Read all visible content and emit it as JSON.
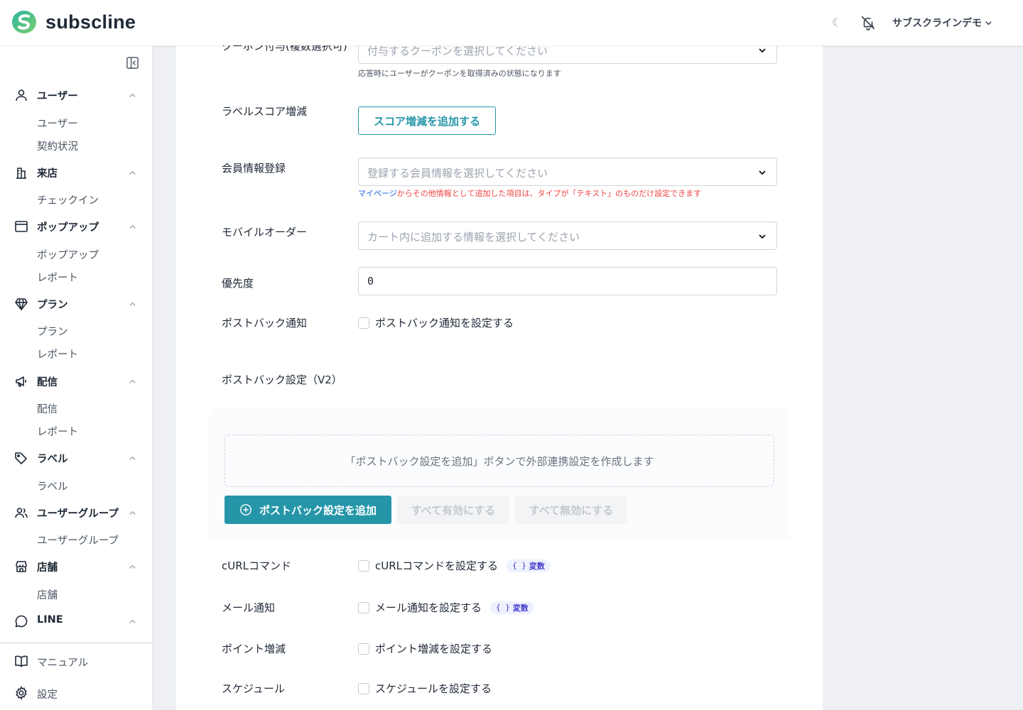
{
  "header": {
    "brand": "subscline",
    "theme_toggle": "☾",
    "user_name": "サブスクラインデモ"
  },
  "sidebar": {
    "groups": [
      {
        "label": "ユーザー",
        "icon": "user-icon",
        "items": [
          "ユーザー",
          "契約状況"
        ]
      },
      {
        "label": "来店",
        "icon": "building-icon",
        "items": [
          "チェックイン"
        ]
      },
      {
        "label": "ポップアップ",
        "icon": "window-icon",
        "items": [
          "ポップアップ",
          "レポート"
        ]
      },
      {
        "label": "プラン",
        "icon": "diamond-icon",
        "items": [
          "プラン",
          "レポート"
        ]
      },
      {
        "label": "配信",
        "icon": "megaphone-icon",
        "items": [
          "配信",
          "レポート"
        ]
      },
      {
        "label": "ラベル",
        "icon": "tag-icon",
        "items": [
          "ラベル"
        ]
      },
      {
        "label": "ユーザーグループ",
        "icon": "users-icon",
        "items": [
          "ユーザーグループ"
        ]
      },
      {
        "label": "店舗",
        "icon": "store-icon",
        "items": [
          "店舗"
        ]
      },
      {
        "label": "LINE",
        "icon": "chat-icon",
        "items": []
      }
    ],
    "bottom": [
      {
        "label": "マニュアル",
        "icon": "book-icon"
      },
      {
        "label": "設定",
        "icon": "gear-icon"
      }
    ]
  },
  "form": {
    "coupon": {
      "label": "クーポン付与(複数選択可)",
      "placeholder": "付与するクーポンを選択してください",
      "help": "応答時にユーザーがクーポンを取得済みの状態になります"
    },
    "label_score": {
      "label": "ラベルスコア増減",
      "button": "スコア増減を追加する"
    },
    "member_info": {
      "label": "会員情報登録",
      "placeholder": "登録する会員情報を選択してください",
      "help_link": "マイページ",
      "help_rest": "からその他情報として追加した項目は、タイプが「テキスト」のものだけ設定できます"
    },
    "mobile_order": {
      "label": "モバイルオーダー",
      "placeholder": "カート内に追加する情報を選択してください"
    },
    "priority": {
      "label": "優先度",
      "value": "0"
    },
    "postback_notify": {
      "label": "ポストバック通知",
      "checkbox": "ポストバック通知を設定する"
    },
    "postback_v2": {
      "label": "ポストバック設定（V2）",
      "empty_text": "「ポストバック設定を追加」ボタンで外部連携設定を作成します",
      "add_button": "ポストバック設定を追加",
      "enable_all": "すべて有効にする",
      "disable_all": "すべて無効にする"
    },
    "curl": {
      "label": "cURLコマンド",
      "checkbox": "cURLコマンドを設定する",
      "badge": "変数",
      "badge_brace": "{ }"
    },
    "mail": {
      "label": "メール通知",
      "checkbox": "メール通知を設定する",
      "badge": "変数",
      "badge_brace": "{ }"
    },
    "points": {
      "label": "ポイント増減",
      "checkbox": "ポイント増減を設定する"
    },
    "schedule": {
      "label": "スケジュール",
      "checkbox": "スケジュールを設定する"
    }
  },
  "colors": {
    "accent": "#2596a8",
    "error": "#ef4444",
    "link": "#2563eb"
  }
}
